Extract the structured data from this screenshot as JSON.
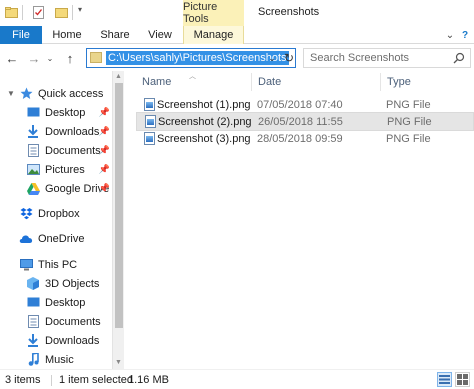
{
  "titlebar": {
    "picture_tools_label": "Picture Tools",
    "window_title": "Screenshots",
    "icons": [
      "folder-icon",
      "properties-check-icon",
      "new-folder-icon",
      "customize-dropdown-icon"
    ]
  },
  "ribbon": {
    "tabs": [
      {
        "label": "File"
      },
      {
        "label": "Home"
      },
      {
        "label": "Share"
      },
      {
        "label": "View"
      },
      {
        "label": "Manage"
      }
    ],
    "collapse_icon": "chevron-down-icon",
    "help_icon": "help-icon"
  },
  "navbar": {
    "back_icon": "arrow-left-icon",
    "forward_icon": "arrow-right-icon",
    "recent_icon": "chevron-down-icon",
    "up_icon": "arrow-up-icon",
    "address_value": "C:\\Users\\sahly\\Pictures\\Screenshots",
    "refresh_icon": "refresh-icon",
    "search_placeholder": "Search Screenshots"
  },
  "sidebar": {
    "items": [
      {
        "label": "Quick access",
        "icon": "star-icon",
        "pinned": false
      },
      {
        "label": "Desktop",
        "icon": "desktop-icon",
        "pinned": true
      },
      {
        "label": "Downloads",
        "icon": "download-icon",
        "pinned": true
      },
      {
        "label": "Documents",
        "icon": "documents-icon",
        "pinned": true
      },
      {
        "label": "Pictures",
        "icon": "pictures-icon",
        "pinned": true
      },
      {
        "label": "Google Drive",
        "icon": "google-drive-icon",
        "pinned": true
      },
      {
        "label": "Dropbox",
        "icon": "dropbox-icon",
        "pinned": false
      },
      {
        "label": "OneDrive",
        "icon": "onedrive-icon",
        "pinned": false
      },
      {
        "label": "This PC",
        "icon": "computer-icon",
        "pinned": false
      },
      {
        "label": "3D Objects",
        "icon": "3d-objects-icon",
        "pinned": false
      },
      {
        "label": "Desktop",
        "icon": "desktop-icon",
        "pinned": false
      },
      {
        "label": "Documents",
        "icon": "documents-icon",
        "pinned": false
      },
      {
        "label": "Downloads",
        "icon": "download-icon",
        "pinned": false
      },
      {
        "label": "Music",
        "icon": "music-icon",
        "pinned": false
      }
    ]
  },
  "filelist": {
    "columns": {
      "name": "Name",
      "date": "Date",
      "type": "Type"
    },
    "rows": [
      {
        "name": "Screenshot (1).png",
        "date": "07/05/2018 07:40",
        "type": "PNG File",
        "selected": false
      },
      {
        "name": "Screenshot (2).png",
        "date": "26/05/2018 11:55",
        "type": "PNG File",
        "selected": true
      },
      {
        "name": "Screenshot (3).png",
        "date": "28/05/2018 09:59",
        "type": "PNG File",
        "selected": false
      }
    ]
  },
  "statusbar": {
    "item_count": "3 items",
    "selection": "1 item selected",
    "size": "1.16 MB",
    "view_icons": [
      "details-view-icon",
      "large-icons-view-icon"
    ]
  },
  "colors": {
    "accent": "#1979ca",
    "contextual_tab": "#fbf1b8",
    "selection": "#3391e6",
    "selected_row": "#e5e5e5"
  }
}
